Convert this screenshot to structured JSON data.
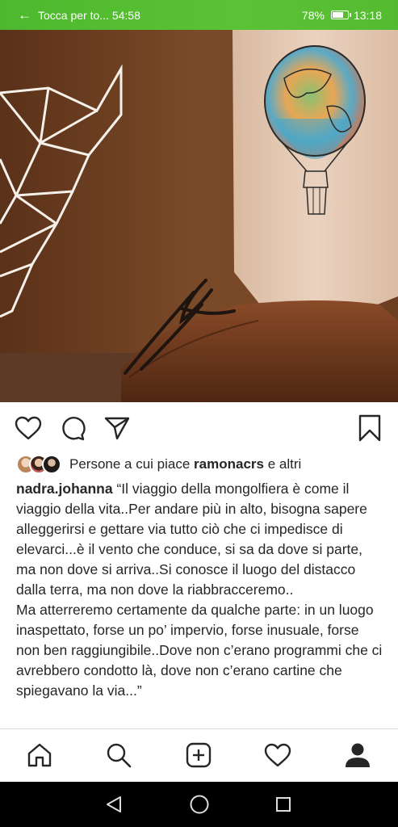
{
  "status_bar": {
    "back_icon": "arrow-left-icon",
    "call_text": "Tocca per to... 54:58",
    "battery_percent_label": "78%",
    "battery_level": 0.78,
    "time": "13:18"
  },
  "post": {
    "image_icon": "hot-air-balloon-tattoo-photo",
    "actions": {
      "like_icon": "heart-icon",
      "comment_icon": "comment-icon",
      "share_icon": "send-icon",
      "save_icon": "bookmark-icon"
    },
    "likes": {
      "prefix": "Persone a cui piace ",
      "user": "ramonacrs",
      "suffix": " e altri"
    },
    "caption": {
      "username": "nadra.johanna",
      "text1": " “Il viaggio della mongolfiera è come il viaggio della vita..Per andare più in alto, bisogna sapere alleggerirsi e gettare via tutto ciò che ci impedisce di elevarci...è il vento che conduce, si sa da dove si parte, ma non dove si arriva..Si conosce il luogo del distacco dalla terra, ma non dove la riabbracceremo..",
      "text2": "Ma atterreremo certamente da qualche parte: in un luogo inaspettato, forse un po’ impervio, forse inusuale, forse non ben raggiungibile..Dove non c’erano programmi che ci avrebbero condotto là, dove non c’erano cartine che spiegavano la via...”"
    }
  },
  "bottom_nav": {
    "items": [
      "home-icon",
      "search-icon",
      "add-post-icon",
      "activity-heart-icon",
      "profile-icon"
    ]
  },
  "system_nav": {
    "items": [
      "back-triangle-icon",
      "home-circle-icon",
      "recents-square-icon"
    ]
  }
}
